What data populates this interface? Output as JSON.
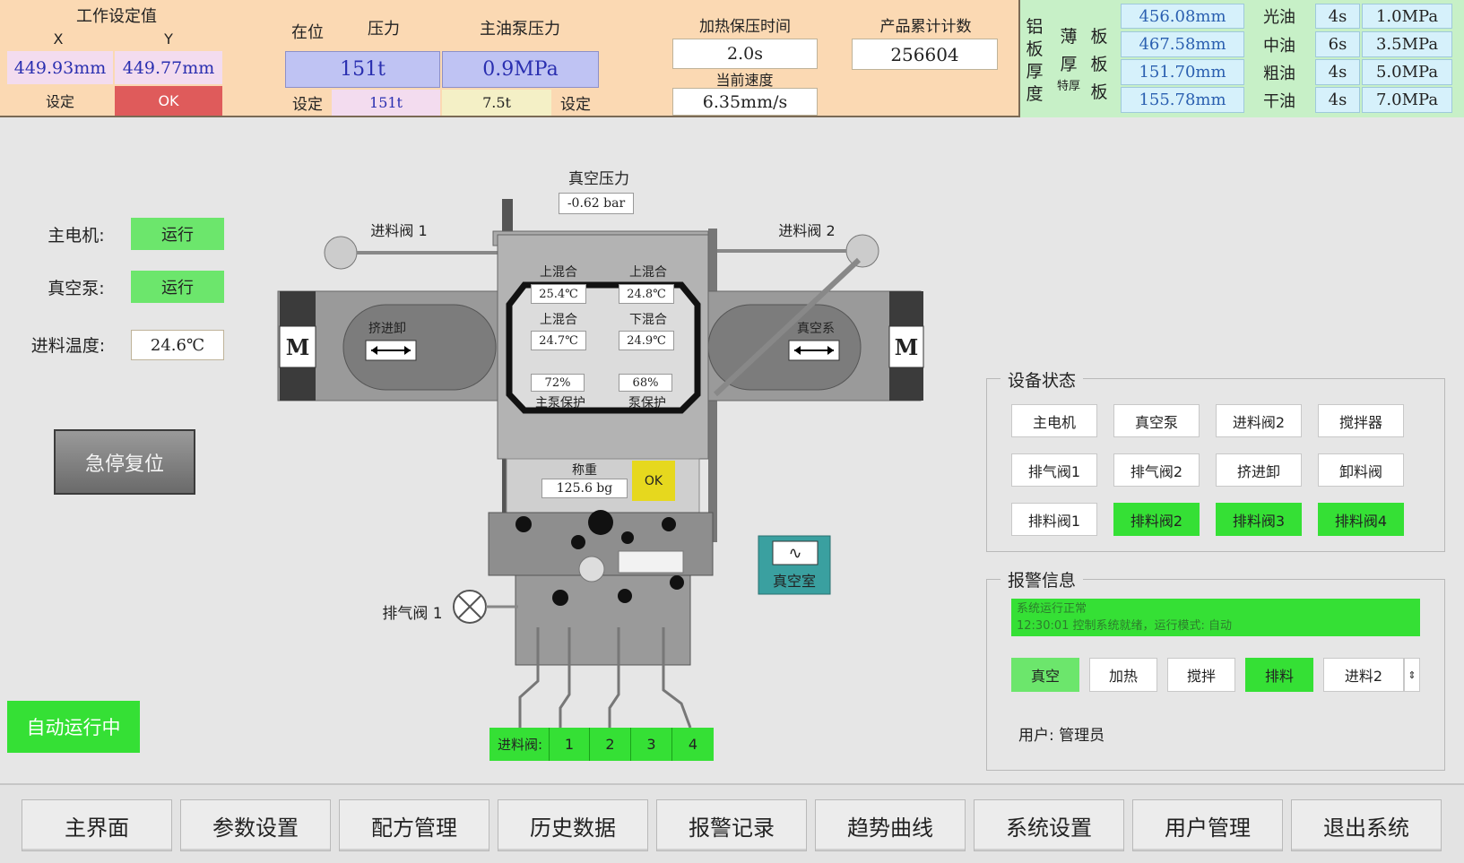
{
  "top": {
    "work_title": "工作设定值",
    "x_label": "X",
    "y_label": "Y",
    "x_value": "449.93mm",
    "y_value": "449.77mm",
    "set_label": "设定",
    "status_ok": "OK",
    "in_place_label": "在位",
    "pressure_label": "压力",
    "pump_pressure_label": "主油泵压力",
    "pressure_value": "151t",
    "pump_pressure_value": "0.9MPa",
    "set_left": "设定",
    "pressure_set": "151t",
    "pump_set": "7.5t",
    "set_right": "设定",
    "heat_hold_label": "加热保压时间",
    "heat_hold_value": "2.0s",
    "speed_label": "当前速度",
    "speed_value": "6.35mm/s",
    "count_label": "产品累计计数",
    "count_value": "256604"
  },
  "thickness": {
    "col1": [
      "铝",
      "板",
      "厚",
      "度"
    ],
    "col2_a": [
      "薄",
      "厚"
    ],
    "col2_b": "特厚",
    "col3": [
      "板",
      "板",
      "板"
    ],
    "values": [
      "456.08mm",
      "467.58mm",
      "151.70mm",
      "155.78mm"
    ],
    "oils": [
      {
        "name": "光油",
        "time": "4s",
        "pressure": "1.0MPa"
      },
      {
        "name": "中油",
        "time": "6s",
        "pressure": "3.5MPa"
      },
      {
        "name": "粗油",
        "time": "4s",
        "pressure": "5.0MPa"
      },
      {
        "name": "干油",
        "time": "4s",
        "pressure": "7.0MPa"
      }
    ]
  },
  "left": {
    "motor_label": "主电机:",
    "motor_status": "运行",
    "vacuum_label": "真空泵:",
    "vacuum_status": "运行",
    "temp_label": "进料温度:",
    "temp_value": "24.6℃",
    "estop_label": "急停复位",
    "auto_label": "自动运行中"
  },
  "diagram": {
    "vac_pressure_label": "真空压力",
    "vac_pressure_value": "-0.62 bar",
    "feed_valve1": "进料阀 1",
    "feed_valve2": "进料阀 2",
    "motor_m": "M",
    "extrude_label": "挤进卸",
    "vacuum_sys_label": "真空系",
    "upper_mix1": "上混合",
    "upper_mix2": "上混合",
    "upper_mix3": "上混合",
    "lower_mix": "下混合",
    "t1": "25.4℃",
    "t2": "24.8℃",
    "t3": "24.7℃",
    "t4": "24.9℃",
    "p1": "72%",
    "p2": "68%",
    "main_pump_protect": "主泵保护",
    "pump_protect": "泵保护",
    "weight_label": "称重",
    "weight_value": "125.6 bg",
    "weight_ok": "OK",
    "exhaust_valve1": "排气阀 1",
    "vacuum_room": "真空室",
    "feed_bar_label": "进料阀:",
    "feed_nums": [
      "1",
      "2",
      "3",
      "4"
    ]
  },
  "status": {
    "title": "设备状态",
    "buttons": [
      {
        "label": "主电机",
        "active": false
      },
      {
        "label": "真空泵",
        "active": false
      },
      {
        "label": "进料阀2",
        "active": false
      },
      {
        "label": "搅拌器",
        "active": false
      },
      {
        "label": "排气阀1",
        "active": false
      },
      {
        "label": "排气阀2",
        "active": false
      },
      {
        "label": "挤进卸",
        "active": false
      },
      {
        "label": "卸料阀",
        "active": false
      },
      {
        "label": "排料阀1",
        "active": false
      },
      {
        "label": "排料阀2",
        "active": true
      },
      {
        "label": "排料阀3",
        "active": true
      },
      {
        "label": "排料阀4",
        "active": true
      }
    ]
  },
  "alarm": {
    "title": "报警信息",
    "line1": "系统运行正常",
    "line2": "12:30:01  控制系统就绪，运行模式: 自动",
    "tabs": [
      {
        "label": "真空",
        "active": true
      },
      {
        "label": "加热",
        "active": false
      },
      {
        "label": "搅拌",
        "active": false
      },
      {
        "label": "排料",
        "active": true
      },
      {
        "label": "进料2",
        "active": false
      }
    ],
    "user_label": "用户: 管理员"
  },
  "nav": [
    "主界面",
    "参数设置",
    "配方管理",
    "历史数据",
    "报警记录",
    "趋势曲线",
    "系统设置",
    "用户管理",
    "退出系统"
  ],
  "colors": {
    "top_bg": "#fbd9b3",
    "green": "#35e035",
    "red_block": "#d90f0f",
    "panel_bg": "#e6e6e6"
  }
}
